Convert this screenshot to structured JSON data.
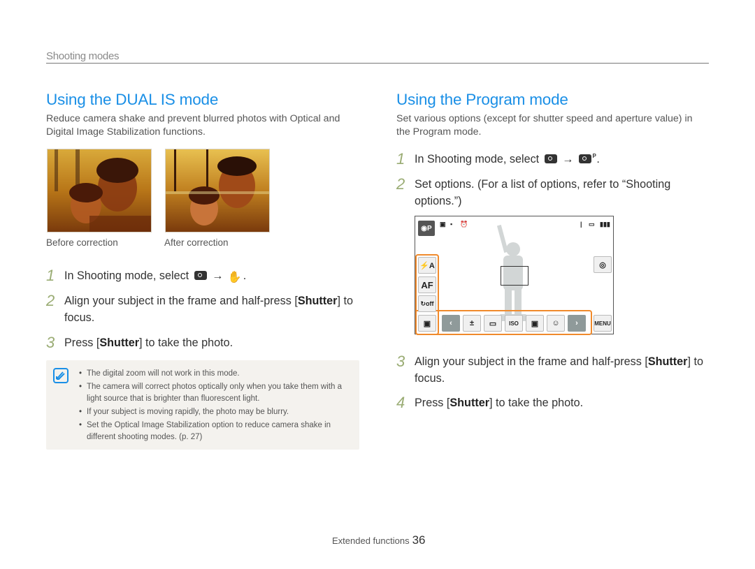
{
  "header": {
    "section": "Shooting modes"
  },
  "left": {
    "title": "Using the DUAL IS mode",
    "intro": "Reduce camera shake and prevent blurred photos with Optical and Digital Image Stabilization functions.",
    "photos": [
      {
        "caption": "Before correction"
      },
      {
        "caption": "After correction"
      }
    ],
    "steps": [
      {
        "num": "1",
        "pre": "In Shooting mode, select",
        "icon1": "camera-icon",
        "arrow": "→",
        "icon2": "dual-is-icon",
        "post": "."
      },
      {
        "num": "2",
        "pre": "Align your subject in the frame and half-press [",
        "bold": "Shutter",
        "post": "] to focus."
      },
      {
        "num": "3",
        "pre": "Press [",
        "bold": "Shutter",
        "post": "] to take the photo."
      }
    ],
    "notes": [
      "The digital zoom will not work in this mode.",
      "The camera will correct photos optically only when you take them with a light source that is brighter than fluorescent light.",
      "If your subject is moving rapidly, the photo may be blurry.",
      "Set the Optical Image Stabilization option to reduce camera shake in different shooting modes. (p. 27)"
    ]
  },
  "right": {
    "title": "Using the Program mode",
    "intro": "Set various options (except for shutter speed and aperture value) in the Program mode.",
    "steps": [
      {
        "num": "1",
        "pre": "In Shooting mode, select",
        "icon1": "camera-icon",
        "arrow": "→",
        "icon2": "program-mode-icon",
        "post": "."
      },
      {
        "num": "2",
        "pre": "Set options. (For a list of options, refer to “Shooting options.”)"
      },
      {
        "num": "3",
        "pre": "Align your subject in the frame and half-press [",
        "bold": "Shutter",
        "post": "] to focus."
      },
      {
        "num": "4",
        "pre": "Press [",
        "bold": "Shutter",
        "post": "] to take the photo."
      }
    ],
    "screen": {
      "mode_icon": "program-mode-icon",
      "status_icons": [
        "image-size-icon",
        "quality-icon",
        "timer-icon"
      ],
      "right_status": [
        "memory-icon",
        "battery-icon"
      ],
      "left_buttons": [
        "flash-auto-icon",
        "af-icon",
        "ois-off-icon",
        "display-settings-icon"
      ],
      "left_labels": [
        "⚡A",
        "AF",
        "↻off",
        "▣"
      ],
      "bottom_buttons": [
        "prev-icon",
        "ev-icon",
        "white-balance-icon",
        "iso-icon",
        "metering-icon",
        "face-detect-off-icon",
        "next-icon"
      ],
      "bottom_labels": [
        "‹",
        "±",
        "▭",
        "ISO",
        "▣",
        "☺",
        "›"
      ],
      "menu_label": "MENU"
    }
  },
  "footer": {
    "label": "Extended functions",
    "page": "36"
  }
}
